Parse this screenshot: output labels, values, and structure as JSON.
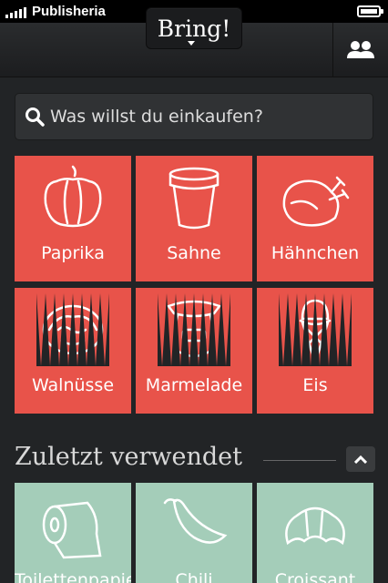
{
  "status_bar": {
    "carrier": "Publisheria"
  },
  "header": {
    "title": "Bring!"
  },
  "search": {
    "placeholder": "Was willst du einkaufen?"
  },
  "items": [
    {
      "label": "Paprika",
      "icon": "paprika-icon"
    },
    {
      "label": "Sahne",
      "icon": "cream-cup-icon"
    },
    {
      "label": "Hähnchen",
      "icon": "chicken-icon"
    },
    {
      "label": "Walnüsse",
      "icon": "walnut-icon"
    },
    {
      "label": "Marmelade",
      "icon": "jam-jar-icon"
    },
    {
      "label": "Eis",
      "icon": "ice-cream-icon"
    }
  ],
  "recent": {
    "title": "Zuletzt verwendet",
    "items": [
      {
        "label": "Toilettenpapier",
        "icon": "toilet-paper-icon"
      },
      {
        "label": "Chili",
        "icon": "chili-icon"
      },
      {
        "label": "Croissant",
        "icon": "croissant-icon"
      }
    ]
  },
  "colors": {
    "item_tile": "#e8534a",
    "recent_tile": "#a4cdb9",
    "background": "#222426"
  }
}
